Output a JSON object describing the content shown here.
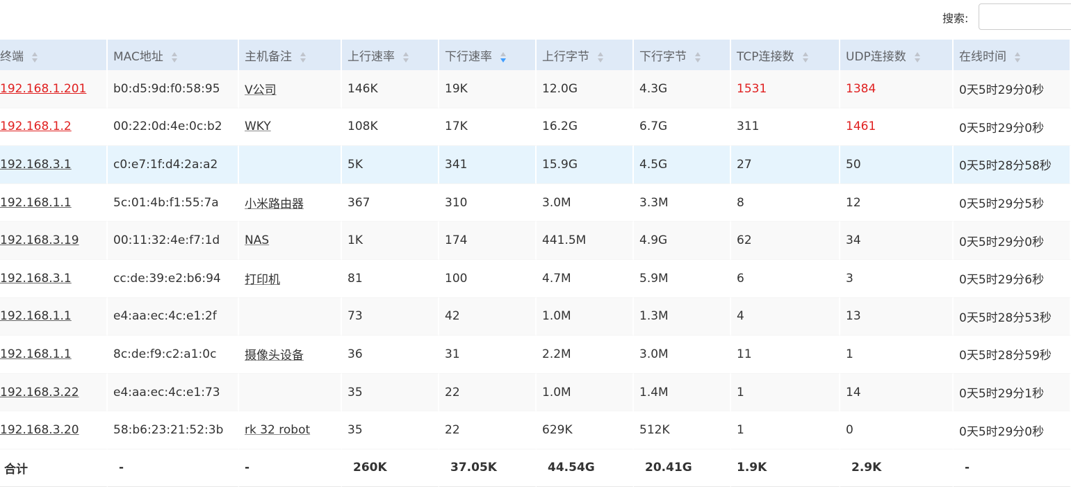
{
  "search": {
    "label": "搜索:",
    "placeholder": "",
    "value": ""
  },
  "table": {
    "columns": [
      {
        "label": "终端",
        "sort": "none"
      },
      {
        "label": "MAC地址",
        "sort": "none"
      },
      {
        "label": "主机备注",
        "sort": "none"
      },
      {
        "label": "上行速率",
        "sort": "none"
      },
      {
        "label": "下行速率",
        "sort": "desc"
      },
      {
        "label": "上行字节",
        "sort": "none"
      },
      {
        "label": "下行字节",
        "sort": "none"
      },
      {
        "label": "TCP连接数",
        "sort": "none"
      },
      {
        "label": "UDP连接数",
        "sort": "none"
      },
      {
        "label": "在线时间",
        "sort": "none"
      }
    ],
    "rows": [
      {
        "ip": "192.168.1.201",
        "mac": "b0:d5:9d:f0:58:95",
        "note": "V公司",
        "up_rate": "146K",
        "down_rate": "19K",
        "up_bytes": "12.0G",
        "down_bytes": "4.3G",
        "tcp": "1531",
        "udp": "1384",
        "online": "0天5时29分0秒"
      },
      {
        "ip": "192.168.1.2",
        "mac": "00:22:0d:4e:0c:b2",
        "note": "WKY",
        "up_rate": "108K",
        "down_rate": "17K",
        "up_bytes": "16.2G",
        "down_bytes": "6.7G",
        "tcp": "311",
        "udp": "1461",
        "online": "0天5时29分0秒"
      },
      {
        "ip": "192.168.3.1",
        "mac": "c0:e7:1f:d4:2a:a2",
        "note": "",
        "up_rate": "5K",
        "down_rate": "341",
        "up_bytes": "15.9G",
        "down_bytes": "4.5G",
        "tcp": "27",
        "udp": "50",
        "online": "0天5时28分58秒"
      },
      {
        "ip": "192.168.1.1",
        "mac": "5c:01:4b:f1:55:7a",
        "note": "小米路由器",
        "up_rate": "367",
        "down_rate": "310",
        "up_bytes": "3.0M",
        "down_bytes": "3.3M",
        "tcp": "8",
        "udp": "12",
        "online": "0天5时29分5秒"
      },
      {
        "ip": "192.168.3.19",
        "mac": "00:11:32:4e:f7:1d",
        "note": "NAS",
        "up_rate": "1K",
        "down_rate": "174",
        "up_bytes": "441.5M",
        "down_bytes": "4.9G",
        "tcp": "62",
        "udp": "34",
        "online": "0天5时29分0秒"
      },
      {
        "ip": "192.168.3.1",
        "mac": "cc:de:39:e2:b6:94",
        "note": "打印机",
        "up_rate": "81",
        "down_rate": "100",
        "up_bytes": "4.7M",
        "down_bytes": "5.9M",
        "tcp": "6",
        "udp": "3",
        "online": "0天5时29分6秒"
      },
      {
        "ip": "192.168.1.1",
        "mac": "e4:aa:ec:4c:e1:2f",
        "note": "",
        "up_rate": "73",
        "down_rate": "42",
        "up_bytes": "1.0M",
        "down_bytes": "1.3M",
        "tcp": "4",
        "udp": "13",
        "online": "0天5时28分53秒"
      },
      {
        "ip": "192.168.1.1",
        "mac": "8c:de:f9:c2:a1:0c",
        "note": "摄像头设备",
        "up_rate": "36",
        "down_rate": "31",
        "up_bytes": "2.2M",
        "down_bytes": "3.0M",
        "tcp": "11",
        "udp": "1",
        "online": "0天5时28分59秒"
      },
      {
        "ip": "192.168.3.22",
        "mac": "e4:aa:ec:4c:e1:73",
        "note": "",
        "up_rate": "35",
        "down_rate": "22",
        "up_bytes": "1.0M",
        "down_bytes": "1.4M",
        "tcp": "1",
        "udp": "14",
        "online": "0天5时29分1秒"
      },
      {
        "ip": "192.168.3.20",
        "mac": "58:b6:23:21:52:3b",
        "note": "rk 32 robot",
        "up_rate": "35",
        "down_rate": "22",
        "up_bytes": "629K",
        "down_bytes": "512K",
        "tcp": "1",
        "udp": "0",
        "online": "0天5时29分0秒"
      }
    ],
    "totals": {
      "label": "合计",
      "mac": "-",
      "note": "-",
      "up_rate": "260K",
      "down_rate": "37.05K",
      "up_bytes": "44.54G",
      "down_bytes": "20.41G",
      "tcp": "1.9K",
      "udp": "2.9K",
      "online": "-"
    }
  },
  "colors": {
    "header_bg": "#dfeaf7",
    "alert_red": "#e02020",
    "highlight_row": "#e6f4fd",
    "sort_active": "#409eff"
  }
}
